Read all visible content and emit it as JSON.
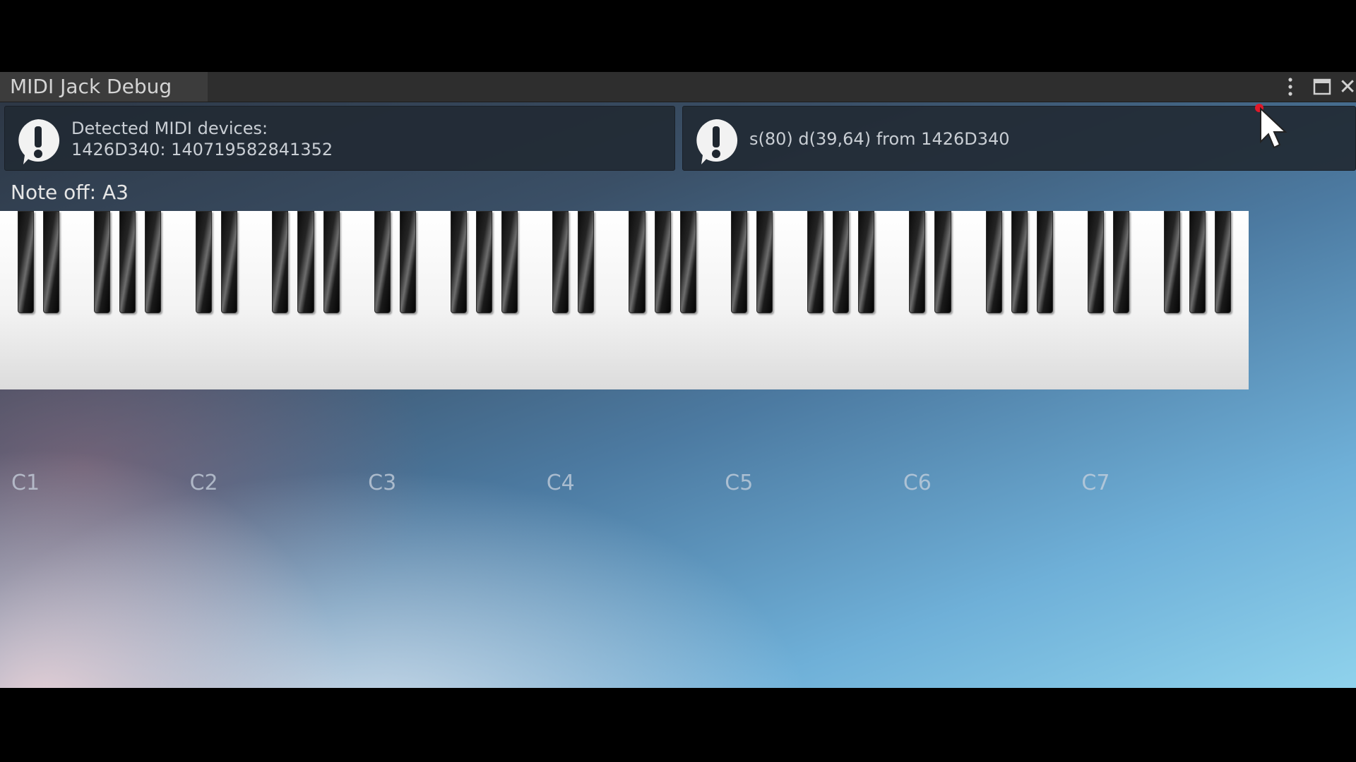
{
  "window": {
    "title": "MIDI Jack Debug"
  },
  "titlebar": {
    "menu_icon": "kebab-menu-icon",
    "maximize_icon": "maximize-icon",
    "close_icon": "close-icon",
    "close_glyph": "✕"
  },
  "help_devices": {
    "icon": "warning-icon",
    "line1": "Detected MIDI devices:",
    "line2": "1426D340: 140719582841352"
  },
  "help_message": {
    "icon": "warning-icon",
    "text": "s(80) d(39,64) from 1426D340"
  },
  "status": {
    "note": "Note off: A3"
  },
  "keyboard": {
    "white_key_count": 49,
    "octaves": 7
  },
  "octave_labels": [
    "C1",
    "C2",
    "C3",
    "C4",
    "C5",
    "C6",
    "C7"
  ],
  "colors": {
    "titlebar": "#2e2e2e",
    "tab": "#3c3c3c",
    "helpbox": "#222a34",
    "status_text": "#e6e6e6",
    "cursor_dot": "#e0192a"
  }
}
